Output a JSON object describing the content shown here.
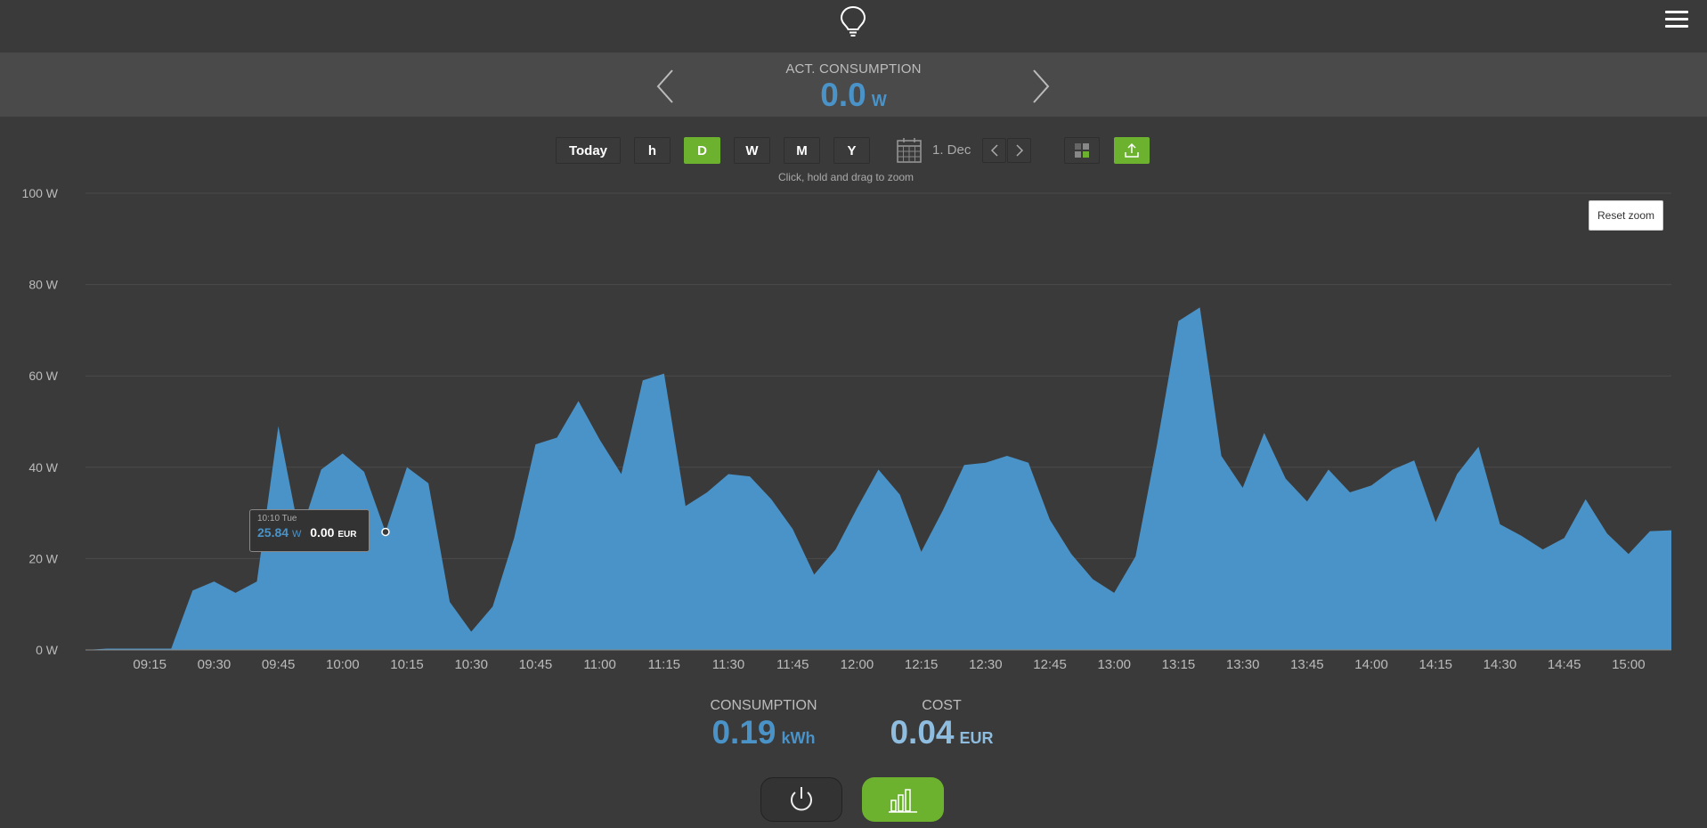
{
  "header": {
    "menu_icon": "hamburger-menu-icon",
    "logo_icon": "lightbulb-icon"
  },
  "actual": {
    "label": "ACT. CONSUMPTION",
    "value": "0.0",
    "unit": "W"
  },
  "toolbar": {
    "today": "Today",
    "periods": [
      {
        "label": "h",
        "active": false
      },
      {
        "label": "D",
        "active": true
      },
      {
        "label": "W",
        "active": false
      },
      {
        "label": "M",
        "active": false
      },
      {
        "label": "Y",
        "active": false
      }
    ],
    "date": "1. Dec",
    "zoom_hint": "Click, hold and drag to zoom",
    "reset_zoom": "Reset zoom"
  },
  "tooltip": {
    "time": "10:10 Tue",
    "power": "25.84",
    "power_unit": "W",
    "cost": "0.00",
    "cost_unit": "EUR"
  },
  "summary": {
    "consumption_label": "CONSUMPTION",
    "consumption_value": "0.19",
    "consumption_unit": "kWh",
    "cost_label": "COST",
    "cost_value": "0.04",
    "cost_unit": "EUR"
  },
  "colors": {
    "accent": "#6cb22e",
    "series": "#4a93c8",
    "cost": "#8fbde0",
    "background": "#3a3a3a"
  },
  "chart_data": {
    "type": "area",
    "ylim": [
      0,
      100
    ],
    "yticks": [
      0,
      20,
      40,
      60,
      80,
      100
    ],
    "ytick_labels": [
      "0 W",
      "20 W",
      "40 W",
      "60 W",
      "80 W",
      "100 W"
    ],
    "xticks": [
      "09:15",
      "09:30",
      "09:45",
      "10:00",
      "10:15",
      "10:30",
      "10:45",
      "11:00",
      "11:15",
      "11:30",
      "11:45",
      "12:00",
      "12:15",
      "12:30",
      "12:45",
      "13:00",
      "13:15",
      "13:30",
      "13:45",
      "14:00",
      "14:15",
      "14:30",
      "14:45",
      "15:00"
    ],
    "x_start": "09:00",
    "step_minutes": 5,
    "series": [
      {
        "values": [
          0,
          0.3,
          0.3,
          0.3,
          0.3,
          13,
          15,
          12.5,
          15,
          49,
          25,
          39.5,
          43,
          39,
          25.84,
          40,
          36.5,
          10.5,
          4,
          9.5,
          24.5,
          45,
          46.5,
          54.5,
          46,
          38.5,
          59,
          60.5,
          31.5,
          34.5,
          38.5,
          38,
          33,
          26.5,
          16.5,
          22,
          31,
          39.5,
          34,
          21.5,
          30.5,
          40.5,
          41,
          42.5,
          41,
          28.5,
          21,
          15.5,
          12.5,
          20.5,
          45,
          72,
          75,
          42.5,
          35.5,
          47.5,
          37.5,
          32.5,
          39.5,
          34.5,
          36,
          39.5,
          41.5,
          28,
          38.5,
          44.5,
          27.5,
          25,
          22,
          24.5,
          33,
          25.5,
          21,
          26,
          26.2
        ]
      }
    ]
  }
}
